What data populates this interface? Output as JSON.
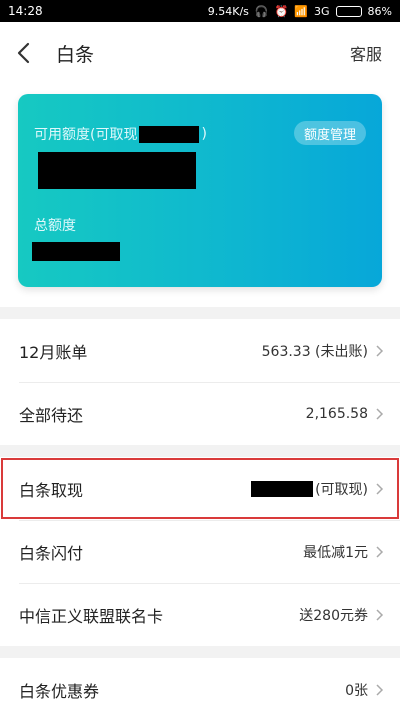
{
  "statusbar": {
    "time": "14:28",
    "speed": "9.54K/s",
    "network": "3G",
    "battery": "86%",
    "battery_level": 0.86
  },
  "navbar": {
    "title": "白条",
    "service": "客服"
  },
  "card": {
    "available_label_prefix": "可用额度(可取现",
    "available_label_suffix": ")",
    "management_button": "额度管理",
    "total_label": "总额度"
  },
  "rows_group1": [
    {
      "label": "12月账单",
      "value": "563.33 (未出账)"
    },
    {
      "label": "全部待还",
      "value": "2,165.58"
    }
  ],
  "rows_group2": [
    {
      "label": "白条取现",
      "value": "(可取现)"
    },
    {
      "label": "白条闪付",
      "value": "最低减1元"
    },
    {
      "label": "中信正义联盟联名卡",
      "value": "送280元券"
    }
  ],
  "rows_group3": [
    {
      "label": "白条优惠券",
      "value": "0张"
    }
  ],
  "colors": {
    "card_start": "#16c9c2",
    "card_end": "#07a7d9",
    "highlight": "#d93a3a"
  }
}
